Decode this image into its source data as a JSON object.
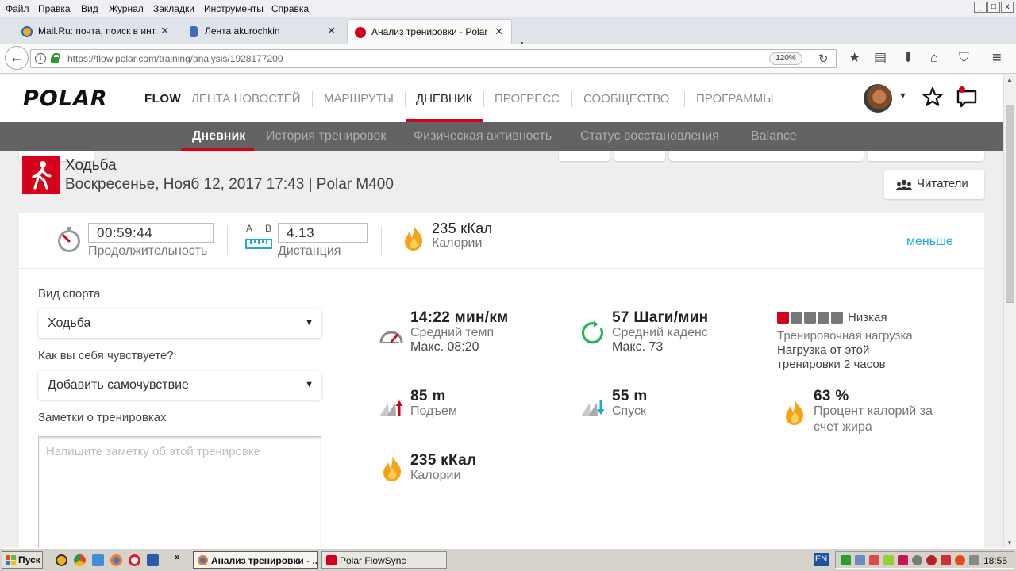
{
  "browser": {
    "menu": [
      "Файл",
      "Правка",
      "Вид",
      "Журнал",
      "Закладки",
      "Инструменты",
      "Справка"
    ],
    "window_controls": [
      "_",
      "□",
      "x"
    ],
    "tabs": [
      {
        "label": "Mail.Ru: почта, поиск в инт...",
        "close": "✕"
      },
      {
        "label": "Лента akurochkin",
        "close": "✕"
      },
      {
        "label": "Анализ тренировки - Polar F...",
        "close": "✕"
      }
    ],
    "new_tab": "+",
    "back": "←",
    "info": "i",
    "url": "https://flow.polar.com/training/analysis/1928177200",
    "zoom": "120%",
    "reload": "↻",
    "toolbar_icons": [
      "★",
      "▤",
      "⬇",
      "⌂",
      "⛉",
      "≡"
    ]
  },
  "polar": {
    "logo": "POLAR",
    "flow": "FLOW",
    "nav": [
      "ЛЕНТА НОВОСТЕЙ",
      "МАРШРУТЫ",
      "ДНЕВНИК",
      "ПРОГРЕСС",
      "СООБЩЕСТВО",
      "ПРОГРАММЫ"
    ],
    "nav_active": "ДНЕВНИК",
    "avatar_caret": "▼",
    "subnav": [
      "Дневник",
      "История тренировок",
      "Физическая активность",
      "Статус восстановления",
      "Balance"
    ],
    "subnav_active": "Дневник"
  },
  "session": {
    "sport": "Ходьба",
    "datetime": "Воскресенье, Нояб 12, 2017 17:43 | Polar M400",
    "readers": "Читатели"
  },
  "summary": {
    "duration_value": "00:59:44",
    "duration_label": "Продолжительность",
    "distance_ab": [
      "A",
      "B"
    ],
    "distance_value": "4.13",
    "distance_label": "Дистанция",
    "calories_value": "235 кКал",
    "calories_label": "Калории",
    "less_link": "меньше"
  },
  "form": {
    "sport_label": "Вид спорта",
    "sport_value": "Ходьба",
    "feeling_label": "Как вы себя чувствуете?",
    "feeling_value": "Добавить самочувствие",
    "notes_label": "Заметки о тренировках",
    "notes_placeholder": "Напишите заметку об этой тренировке",
    "caret": "▼"
  },
  "metrics": {
    "pace": {
      "value": "14:22 мин/км",
      "label": "Средний темп",
      "max": "Макс. 08:20"
    },
    "cadence": {
      "value": "57 Шаги/мин",
      "label": "Средний каденс",
      "max": "Макс. 73"
    },
    "load": {
      "level": "Низкая",
      "level_fraction": 0.2,
      "label": "Тренировочная нагрузка",
      "desc1": "Нагрузка от этой",
      "desc2": "тренировки 2 часов"
    },
    "ascent": {
      "value": "85 m",
      "label": "Подъем"
    },
    "descent": {
      "value": "55 m",
      "label": "Спуск"
    },
    "fat": {
      "value": "63 %",
      "label1": "Процент калорий за",
      "label2": "счет жира"
    },
    "calories": {
      "value": "235 кКал",
      "label": "Калории"
    }
  },
  "colors": {
    "polar_red": "#d4001c",
    "link_blue": "#1fa8d8",
    "subnav_bg": "#636363"
  },
  "taskbar": {
    "start": "Пуск",
    "overflow": "»",
    "windows": [
      "Анализ тренировки - ...",
      "Polar FlowSync"
    ],
    "lang": "EN",
    "clock": "18:55"
  }
}
